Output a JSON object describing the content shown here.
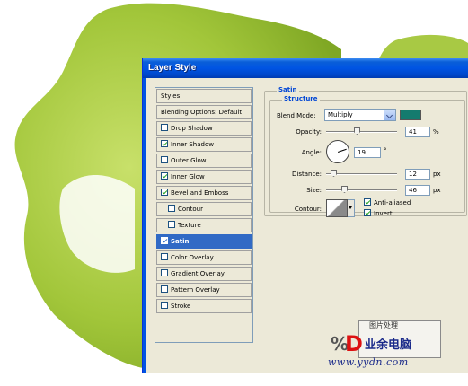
{
  "window": {
    "title": "Layer Style"
  },
  "styles_panel": {
    "items": [
      {
        "label": "Styles",
        "checkbox": false,
        "checked": false,
        "sub": false,
        "selected": false
      },
      {
        "label": "Blending Options: Default",
        "checkbox": false,
        "checked": false,
        "sub": false,
        "selected": false
      },
      {
        "label": "Drop Shadow",
        "checkbox": true,
        "checked": false,
        "sub": false,
        "selected": false
      },
      {
        "label": "Inner Shadow",
        "checkbox": true,
        "checked": true,
        "sub": false,
        "selected": false
      },
      {
        "label": "Outer Glow",
        "checkbox": true,
        "checked": false,
        "sub": false,
        "selected": false
      },
      {
        "label": "Inner Glow",
        "checkbox": true,
        "checked": true,
        "sub": false,
        "selected": false
      },
      {
        "label": "Bevel and Emboss",
        "checkbox": true,
        "checked": true,
        "sub": false,
        "selected": false
      },
      {
        "label": "Contour",
        "checkbox": true,
        "checked": false,
        "sub": true,
        "selected": false
      },
      {
        "label": "Texture",
        "checkbox": true,
        "checked": false,
        "sub": true,
        "selected": false
      },
      {
        "label": "Satin",
        "checkbox": true,
        "checked": true,
        "sub": false,
        "selected": true
      },
      {
        "label": "Color Overlay",
        "checkbox": true,
        "checked": false,
        "sub": false,
        "selected": false
      },
      {
        "label": "Gradient Overlay",
        "checkbox": true,
        "checked": false,
        "sub": false,
        "selected": false
      },
      {
        "label": "Pattern Overlay",
        "checkbox": true,
        "checked": false,
        "sub": false,
        "selected": false
      },
      {
        "label": "Stroke",
        "checkbox": true,
        "checked": false,
        "sub": false,
        "selected": false
      }
    ]
  },
  "satin": {
    "section_title": "Satin",
    "structure_title": "Structure",
    "blend_mode_label": "Blend Mode:",
    "blend_mode_value": "Multiply",
    "color": "#147b6e",
    "opacity_label": "Opacity:",
    "opacity_value": "41",
    "opacity_unit": "%",
    "angle_label": "Angle:",
    "angle_value": "19",
    "angle_unit": "°",
    "distance_label": "Distance:",
    "distance_value": "12",
    "distance_unit": "px",
    "size_label": "Size:",
    "size_value": "46",
    "size_unit": "px",
    "contour_label": "Contour:",
    "anti_aliased_label": "Anti-aliased",
    "anti_aliased_checked": true,
    "invert_label": "Invert",
    "invert_checked": true
  },
  "watermark": {
    "top_text": "图片处理",
    "brand_text": "业余电脑",
    "url": "www.yydn.com"
  }
}
